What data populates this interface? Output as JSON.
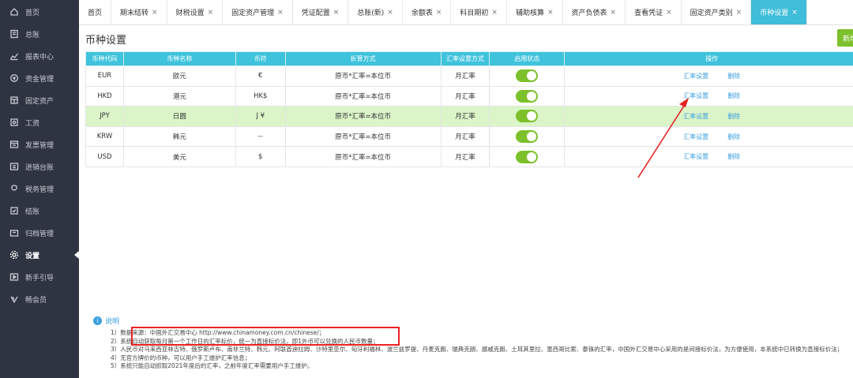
{
  "sidebar": {
    "items": [
      {
        "label": "首页",
        "icon": "home-icon"
      },
      {
        "label": "总账",
        "icon": "ledger-icon"
      },
      {
        "label": "报表中心",
        "icon": "report-icon"
      },
      {
        "label": "资金管理",
        "icon": "funds-icon"
      },
      {
        "label": "固定资产",
        "icon": "asset-icon"
      },
      {
        "label": "工资",
        "icon": "salary-icon"
      },
      {
        "label": "发票管理",
        "icon": "invoice-icon"
      },
      {
        "label": "进销台账",
        "icon": "stock-icon"
      },
      {
        "label": "税务管理",
        "icon": "tax-icon"
      },
      {
        "label": "结账",
        "icon": "close-books-icon"
      },
      {
        "label": "归档管理",
        "icon": "archive-icon"
      },
      {
        "label": "设置",
        "icon": "settings-icon"
      },
      {
        "label": "新手引导",
        "icon": "guide-icon"
      },
      {
        "label": "畅会员",
        "icon": "vip-icon"
      }
    ],
    "active_index": 11
  },
  "tabs": [
    {
      "label": "首页",
      "closable": false
    },
    {
      "label": "期末结转",
      "closable": true
    },
    {
      "label": "财税设置",
      "closable": true
    },
    {
      "label": "固定资产管理",
      "closable": true
    },
    {
      "label": "凭证配置",
      "closable": true
    },
    {
      "label": "总账(新)",
      "closable": true
    },
    {
      "label": "余额表",
      "closable": true
    },
    {
      "label": "科目期初",
      "closable": true
    },
    {
      "label": "辅助核算",
      "closable": true
    },
    {
      "label": "资产负债表",
      "closable": true
    },
    {
      "label": "查看凭证",
      "closable": true
    },
    {
      "label": "固定资产类别",
      "closable": true
    },
    {
      "label": "币种设置",
      "closable": true,
      "active": true
    }
  ],
  "page": {
    "title": "币种设置",
    "add_button": "新增"
  },
  "table": {
    "headers": [
      "币种代码",
      "币种名称",
      "币符",
      "折算方式",
      "汇率设置方式",
      "启用状态",
      "操作"
    ],
    "rows": [
      {
        "code": "EUR",
        "name": "欧元",
        "symbol": "€",
        "conversion": "原币*汇率=本位币",
        "rate_mode": "月汇率",
        "enabled": true,
        "op_rate": "汇率设置",
        "op_delete": "删除"
      },
      {
        "code": "HKD",
        "name": "港元",
        "symbol": "HK$",
        "conversion": "原币*汇率=本位币",
        "rate_mode": "月汇率",
        "enabled": true,
        "op_rate": "汇率设置",
        "op_delete": "删除"
      },
      {
        "code": "JPY",
        "name": "日圆",
        "symbol": "J ¥",
        "conversion": "原币*汇率=本位币",
        "rate_mode": "月汇率",
        "enabled": true,
        "op_rate": "汇率设置",
        "op_delete": "删除",
        "highlighted": true
      },
      {
        "code": "KRW",
        "name": "韩元",
        "symbol": "--",
        "conversion": "原币*汇率=本位币",
        "rate_mode": "月汇率",
        "enabled": true,
        "op_rate": "汇率设置",
        "op_delete": "删除"
      },
      {
        "code": "USD",
        "name": "美元",
        "symbol": "$",
        "conversion": "原币*汇率=本位币",
        "rate_mode": "月汇率",
        "enabled": true,
        "op_rate": "汇率设置",
        "op_delete": "删除"
      }
    ]
  },
  "notes": {
    "title": "说明",
    "items": [
      "1）数据来源：中国外汇交易中心 http://www.chinamoney.com.cn/chinese/；",
      "2）系统自动获取每月第一个工作日的汇率标价，统一为直接标价法，即1外币可以兑换的人民币数量；",
      "3）人民币对马来西亚林吉特、俄罗斯卢布、南非兰特、韩元、阿联酋迪拉姆、沙特里亚尔、匈牙利福林、波兰兹罗提、丹麦克朗、瑞典克朗、挪威克朗、土耳其里拉、墨西哥比索、泰铢的汇率，中国外汇交易中心采用的是间接标价法，为方便使用，本系统中已转换为直接标价法；",
      "4）无官方牌价的币种，可以用户手工维护汇率信息；",
      "5）系统只能自动抓取2021年度后的汇率，之前年度汇率需要用户手工维护。"
    ]
  },
  "colors": {
    "sidebar_bg": "#2f3442",
    "accent": "#3fbdd9",
    "toggle_on": "#7cc02b",
    "highlight_row": "#dbf5c9",
    "link": "#3aa0e0",
    "annotation": "#e22222"
  }
}
